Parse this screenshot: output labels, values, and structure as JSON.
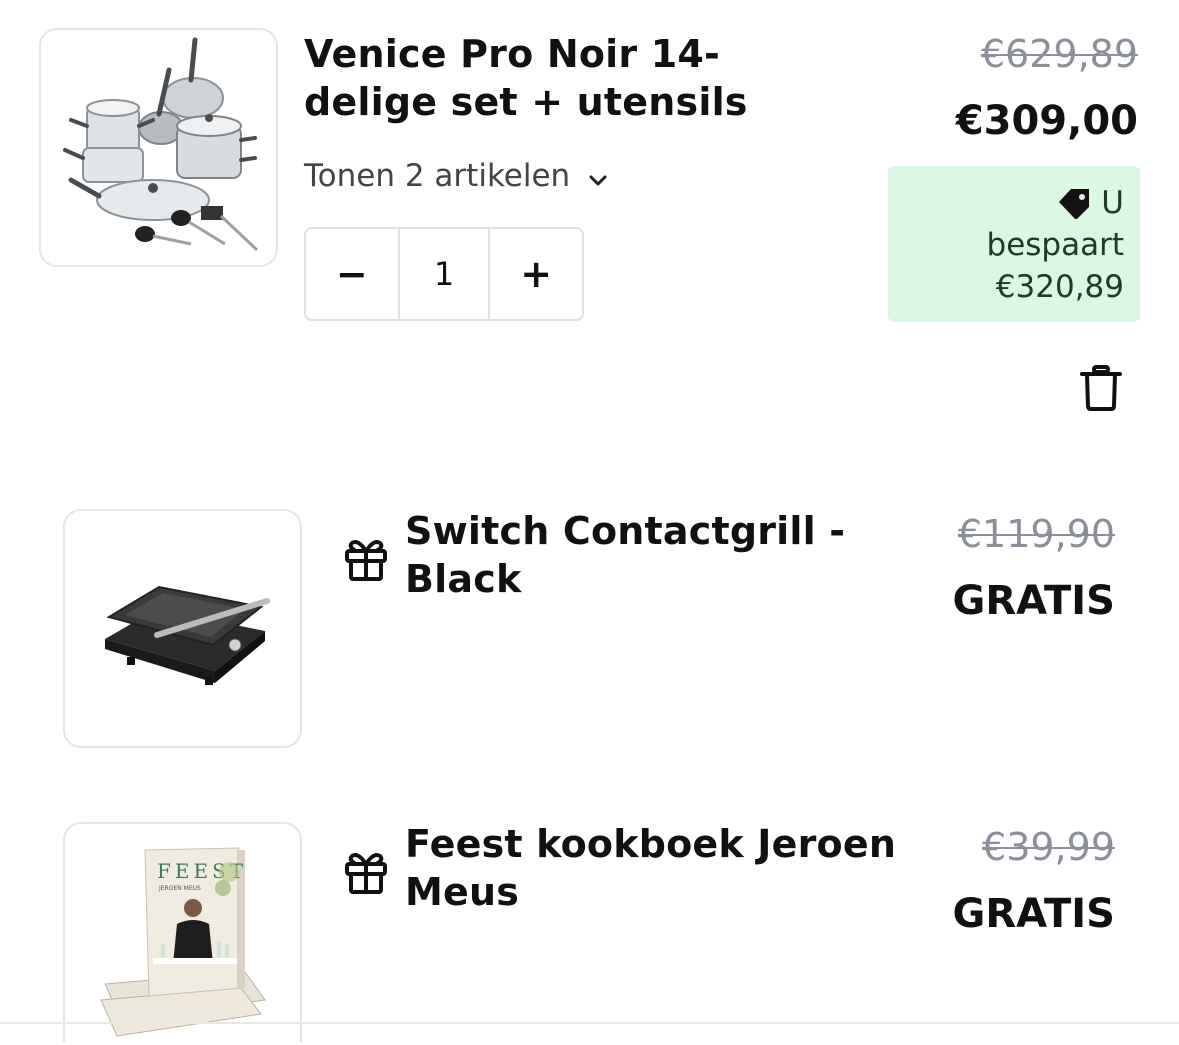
{
  "cart": {
    "main_item": {
      "name": "Venice Pro Noir 14-delige set + utensils",
      "name_line1": "Venice Pro Noir 14-",
      "name_line2": "delige set + utensils",
      "variant_toggle_label": "Tonen 2 artikelen",
      "quantity": "1",
      "decrease_label": "−",
      "increase_label": "+",
      "price_original": "€629,89",
      "price_current": "€309,00",
      "savings_line1": "U",
      "savings_line2": "bespaart",
      "savings_line3": "€320,89",
      "icons": {
        "chevron": "chevron-down-icon",
        "tag": "tag-icon",
        "trash": "trash-icon"
      }
    },
    "gift_items": [
      {
        "name_line1": "Switch Contactgrill -",
        "name_line2": "Black",
        "price_original": "€119,90",
        "price_label": "GRATIS",
        "icon": "gift-icon"
      },
      {
        "name_line1": "Feest kookboek Jeroen",
        "name_line2": "Meus",
        "price_original": "€39,99",
        "price_label": "GRATIS",
        "icon": "gift-icon",
        "book_cover_title": "FEEST",
        "book_cover_author": "JEROEN MEUS"
      }
    ]
  },
  "colors": {
    "savings_bg": "#dcf8e4",
    "savings_text": "#1f3a26",
    "strike_price": "#8a8f99",
    "border": "#e6e6e6"
  }
}
